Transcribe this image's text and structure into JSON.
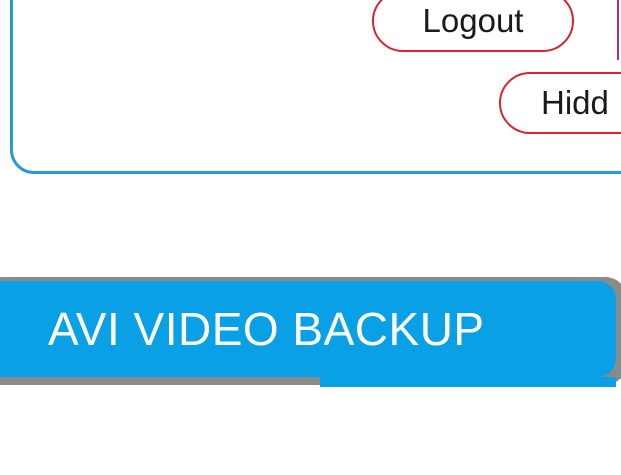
{
  "nav": {
    "logout_label": "Logout",
    "hidden_label": "Hidd"
  },
  "section": {
    "title": "AVI VIDEO BACKUP"
  },
  "colors": {
    "panel_border": "#2a9ad6",
    "pill_border": "#d9232e",
    "banner_bg": "#0aa0e6",
    "banner_shadow": "#8a8a8a"
  }
}
